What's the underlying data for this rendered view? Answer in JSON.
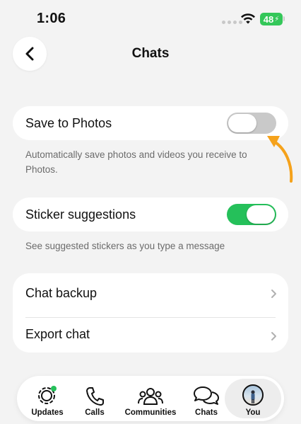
{
  "status_bar": {
    "time": "1:06",
    "battery": "48"
  },
  "header": {
    "title": "Chats"
  },
  "settings": {
    "save_to_photos": {
      "label": "Save to Photos",
      "enabled": false,
      "caption": "Automatically save photos and videos you receive to Photos."
    },
    "sticker_suggestions": {
      "label": "Sticker suggestions",
      "enabled": true,
      "caption": "See suggested stickers as you type a message"
    },
    "chat_backup": {
      "label": "Chat backup"
    },
    "export_chat": {
      "label": "Export chat"
    }
  },
  "tab_bar": {
    "tabs": [
      {
        "label": "Updates",
        "icon": "updates-icon"
      },
      {
        "label": "Calls",
        "icon": "phone-icon"
      },
      {
        "label": "Communities",
        "icon": "communities-icon"
      },
      {
        "label": "Chats",
        "icon": "chats-icon"
      },
      {
        "label": "You",
        "icon": "avatar",
        "selected": true
      }
    ]
  },
  "colors": {
    "accent_green": "#25c05a",
    "toggle_off": "#c9c9c9",
    "arrow": "#f5a21b"
  }
}
